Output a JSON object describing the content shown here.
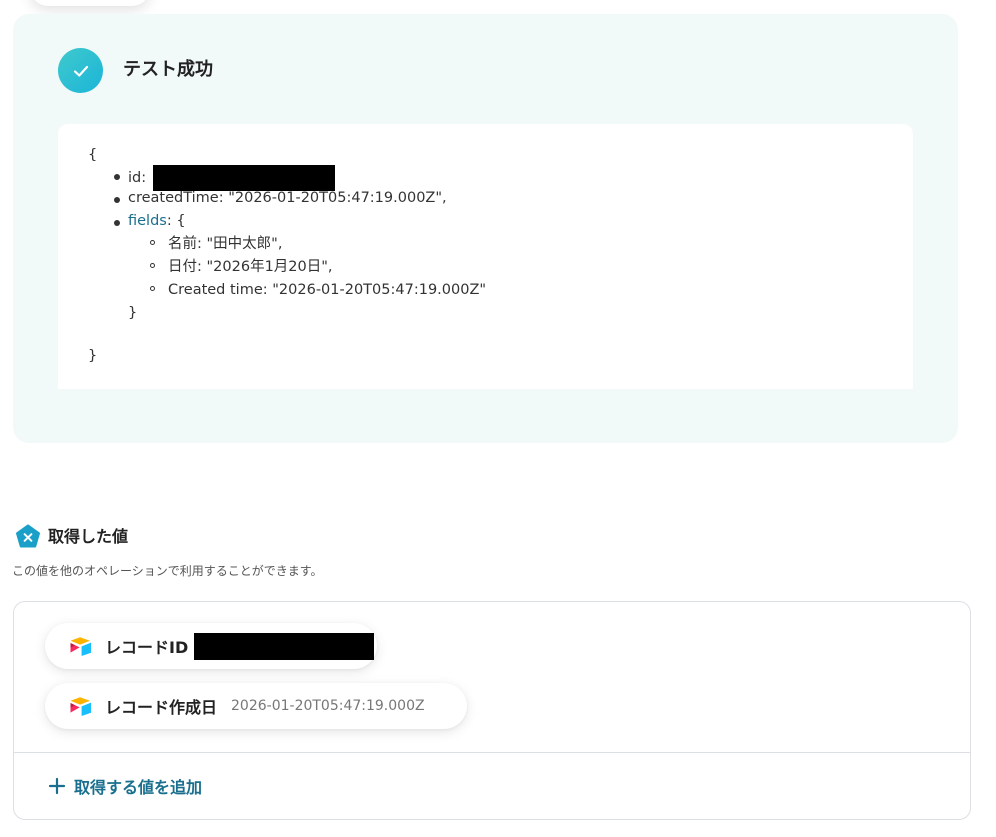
{
  "result": {
    "status_title": "テスト成功",
    "icon": "check-icon",
    "json": {
      "open_brace": "{",
      "id_key": "id:",
      "created_time_line": "createdTime: \"2026-01-20T05:47:19.000Z\",",
      "fields_key": "fields",
      "fields_open": ": {",
      "name_line": "名前: \"田中太郎\",",
      "date_line": "日付: \"2026年1月20日\",",
      "created_time_field_line": "Created time: \"2026-01-20T05:47:19.000Z\"",
      "fields_close": "}",
      "close_brace": "}"
    }
  },
  "retrieved": {
    "title": "取得した値",
    "description": "この値を他のオペレーションで利用することができます。",
    "items": [
      {
        "label": "レコードID",
        "value": ""
      },
      {
        "label": "レコード作成日",
        "value": "2026-01-20T05:47:19.000Z"
      }
    ],
    "add_label": "取得する値を追加"
  },
  "colors": {
    "accent": "#1a6f8e",
    "success_gradient_start": "#3fc9cc",
    "success_gradient_end": "#1bb5d9",
    "panel_bg": "#f2f9f9",
    "section_icon": "#1aa0c8"
  }
}
